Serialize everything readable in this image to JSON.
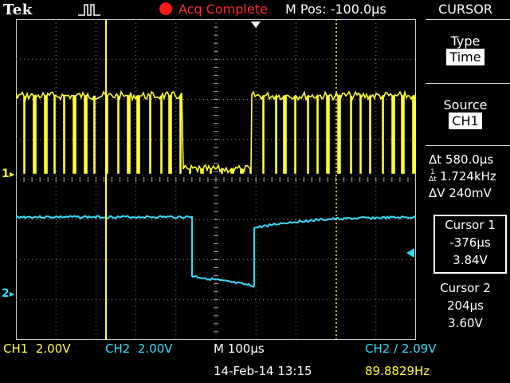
{
  "header": {
    "brand": "Tek",
    "acq_status": "Acq Complete",
    "m_pos": "M Pos: -100.0µs"
  },
  "side_menu": {
    "title": "CURSOR",
    "type_label": "Type",
    "type_value": "Time",
    "source_label": "Source",
    "source_value": "CH1",
    "delta_t": "Δt 580.0µs",
    "freq": "1.724kHz",
    "delta_v": "ΔV 240mV",
    "cursor1": {
      "label": "Cursor 1",
      "time": "-376µs",
      "volts": "3.84V"
    },
    "cursor2": {
      "label": "Cursor 2",
      "time": "204µs",
      "volts": "3.60V"
    }
  },
  "status_bar": {
    "ch1": "CH1  2.00V",
    "ch2": "CH2  2.00V",
    "timebase": "M 100µs",
    "trigger": "CH2 ∕ 2.09V",
    "date": "14-Feb-14 13:15",
    "frequency": "89.8829Hz"
  },
  "markers": {
    "ch1": "1",
    "ch2": "2"
  },
  "colors": {
    "ch1": "#ffff33",
    "ch2": "#33ddff",
    "acq": "#ff2a2a",
    "cursor": "#ffff33"
  }
}
